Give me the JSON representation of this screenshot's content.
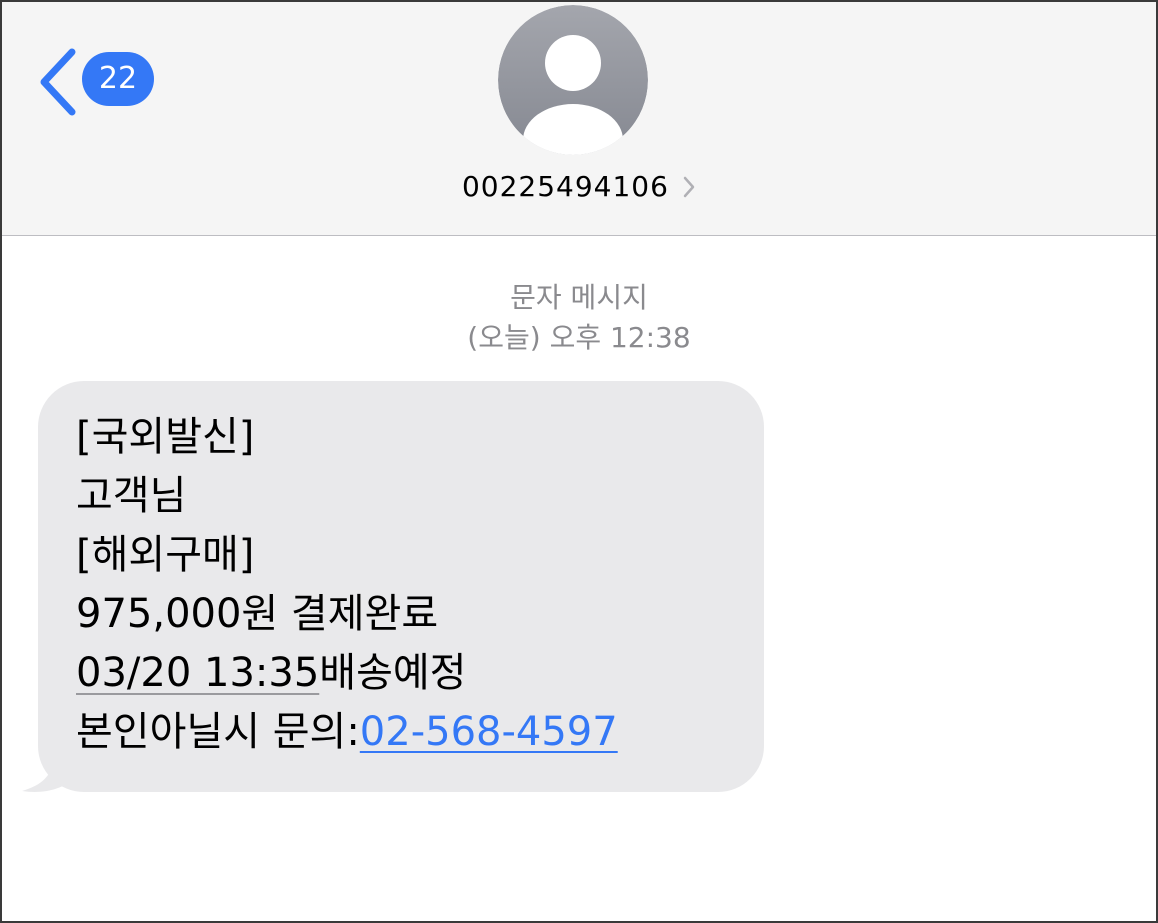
{
  "header": {
    "back_badge_count": "22",
    "contact_number": "00225494106"
  },
  "conversation": {
    "message_type": "문자 메시지",
    "timestamp": "(오늘) 오후 12:38"
  },
  "message": {
    "line1": "[국외발신]",
    "line2": "고객님",
    "line3": "[해외구매]",
    "line4": "975,000원 결제완료",
    "line5_date": "03/20 13:35",
    "line5_rest": "배송예정",
    "line6_prefix": "본인아닐시 문의:",
    "line6_phone": "02-568-4597"
  },
  "colors": {
    "accent": "#3478f6",
    "bubble": "#e9e9eb",
    "header_bg": "#f5f5f5",
    "meta_text": "#8a8a8e"
  },
  "icons": {
    "back": "chevron-left-icon",
    "avatar": "person-icon",
    "contact_details": "chevron-right-icon"
  }
}
